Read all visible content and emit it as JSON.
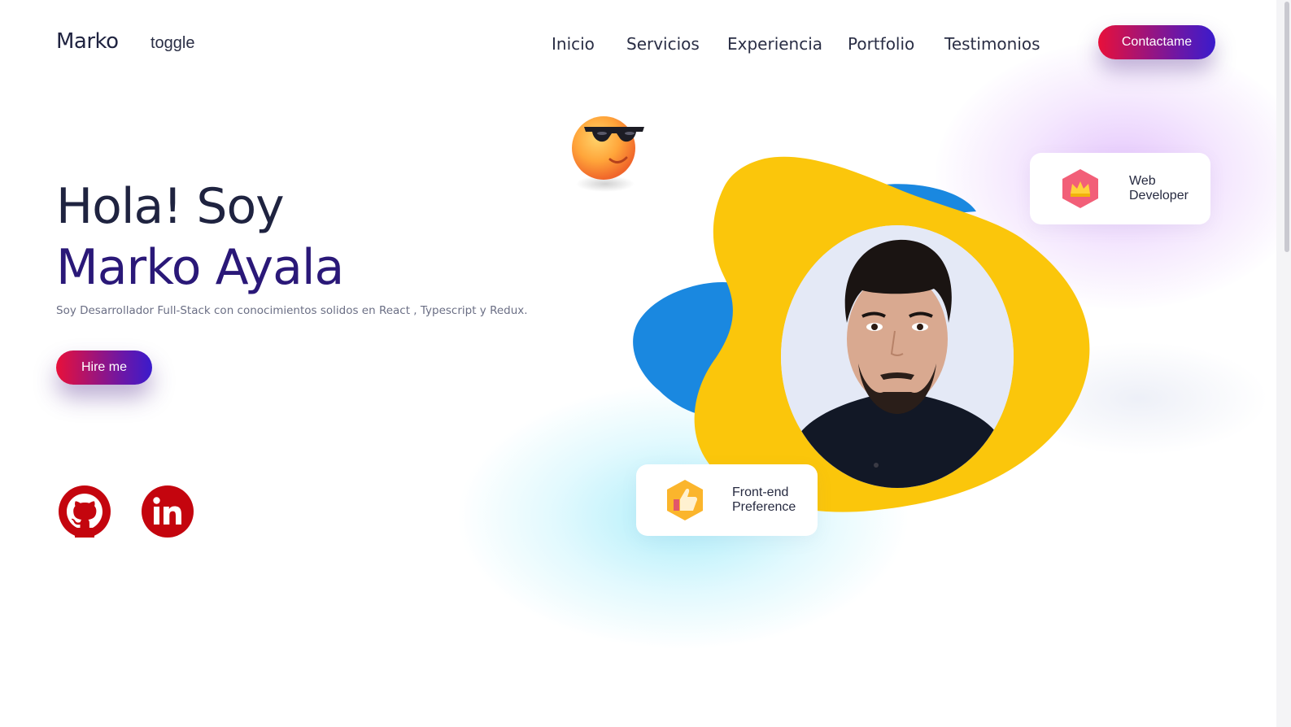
{
  "header": {
    "logo": "Marko",
    "toggle_label": "toggle",
    "nav": [
      "Inicio",
      "Servicios",
      "Experiencia",
      "Portfolio",
      "Testimonios"
    ],
    "contact_label": "Contactame"
  },
  "hero": {
    "greeting": "Hola! Soy",
    "name": "Marko Ayala",
    "description": "Soy Desarrollador Full-Stack con conocimientos solidos en React , Typescript y Redux.",
    "hire_label": "Hire me"
  },
  "social": {
    "icons": [
      "github-icon",
      "linkedin-icon"
    ],
    "color": "#c4050e"
  },
  "badges": {
    "web": {
      "line1": "Web",
      "line2": "Developer",
      "icon": "crown-icon"
    },
    "frontend": {
      "line1": "Front-end",
      "line2": "Preference",
      "icon": "thumbs-up-icon"
    }
  },
  "colors": {
    "accent_gradient_start": "#e8103a",
    "accent_gradient_end": "#3a1bcc",
    "blob_yellow": "#fbc60b",
    "blob_blue": "#1a88e0",
    "name_color": "#2a1878"
  }
}
